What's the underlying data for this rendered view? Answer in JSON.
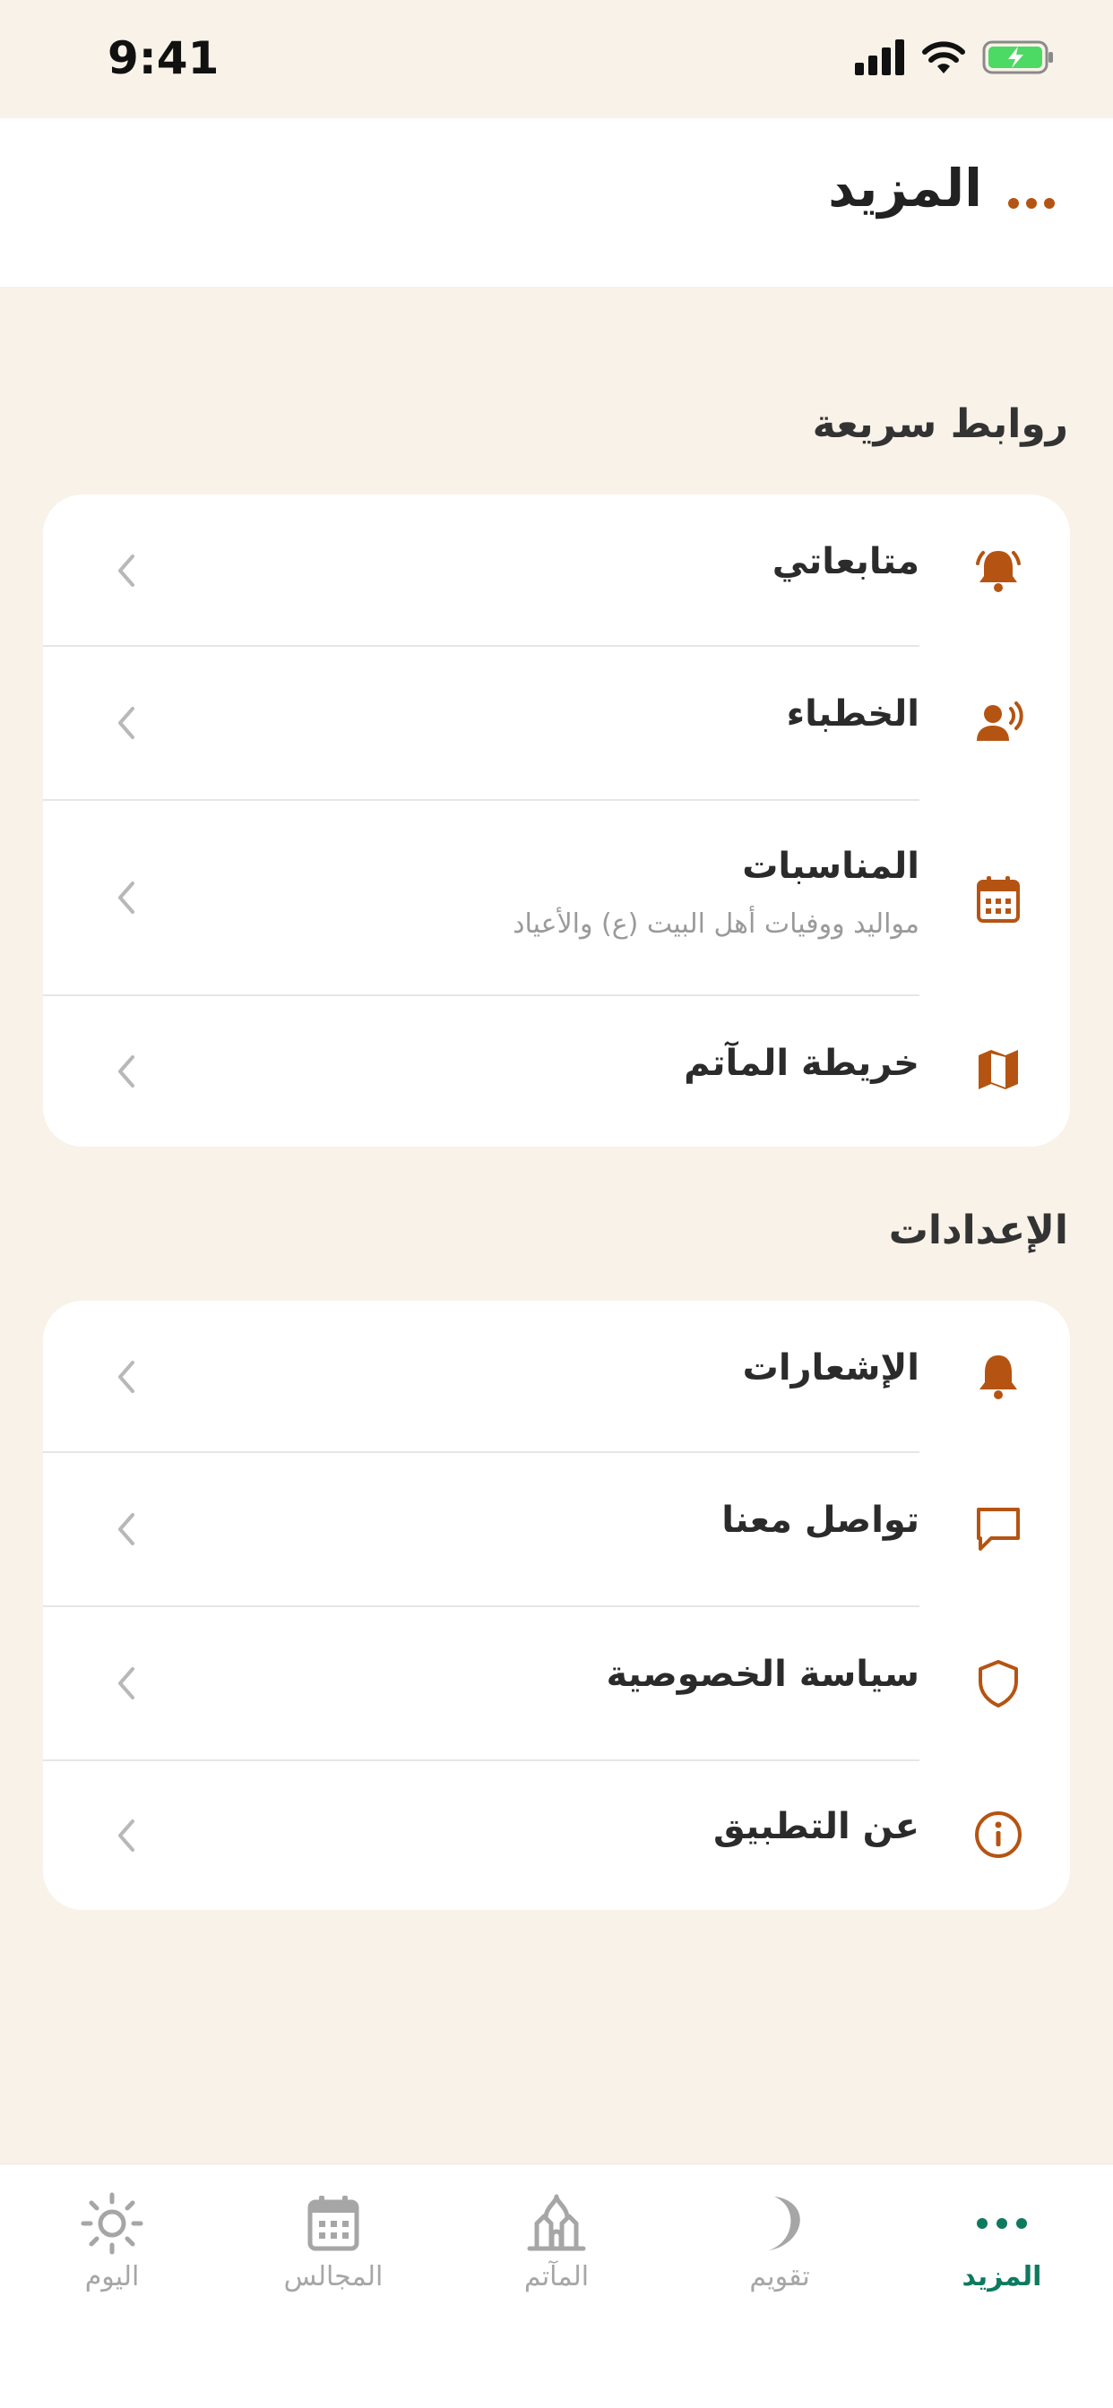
{
  "status": {
    "time": "9:41"
  },
  "header": {
    "title": "المزيد"
  },
  "quick_links": {
    "title": "روابط سريعة",
    "items": [
      {
        "label": "متابعاتي",
        "icon": "bell-ring-icon"
      },
      {
        "label": "الخطباء",
        "icon": "speaker-icon"
      },
      {
        "label": "المناسبات",
        "subtitle": "مواليد ووفيات أهل البيت (ع) والأعياد",
        "icon": "calendar-icon"
      },
      {
        "label": "خريطة المآتم",
        "icon": "map-icon"
      }
    ]
  },
  "settings": {
    "title": "الإعدادات",
    "items": [
      {
        "label": "الإشعارات",
        "icon": "bell-icon"
      },
      {
        "label": "تواصل معنا",
        "icon": "chat-icon"
      },
      {
        "label": "سياسة الخصوصية",
        "icon": "shield-icon"
      },
      {
        "label": "عن التطبيق",
        "icon": "info-icon"
      }
    ]
  },
  "tabbar": {
    "items": [
      {
        "label": "اليوم",
        "icon": "sun-icon"
      },
      {
        "label": "المجالس",
        "icon": "calendar-icon"
      },
      {
        "label": "المآتم",
        "icon": "mosque-icon"
      },
      {
        "label": "تقويم",
        "icon": "moon-icon"
      },
      {
        "label": "المزيد",
        "icon": "more-icon",
        "active": true
      }
    ]
  },
  "colors": {
    "accent": "#b55412",
    "active_tab": "#0d7a5f",
    "background": "#f8f2e8"
  }
}
